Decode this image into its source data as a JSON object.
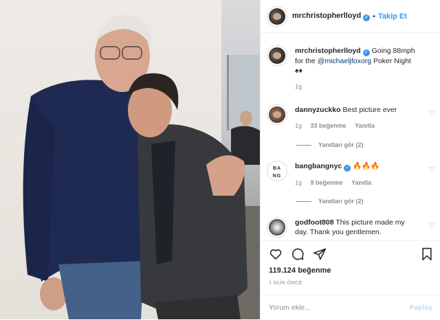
{
  "photo": {
    "alt": ""
  },
  "header": {
    "username": "mrchristopherlloyd",
    "separator": "•",
    "follow_label": "Takip Et"
  },
  "caption": {
    "username": "mrchristopherlloyd",
    "text_before": "Going 88mph for the ",
    "mention": "@michaeljfoxorg",
    "text_after": " Poker Night",
    "suits": "♠♦",
    "time": "1g"
  },
  "comments": [
    {
      "username": "dannyzuckko",
      "text": "Best picture ever",
      "time": "1g",
      "likes": "33 beğenme",
      "reply": "Yanıtla",
      "replies": "Yanıtları gör (2)"
    },
    {
      "username": "bangbangnyc",
      "avatar_text": "BA NG",
      "text": "🔥🔥🔥",
      "time": "1g",
      "likes": "9 beğenme",
      "reply": "Yanıtla",
      "replies": "Yanıtları gör (2)"
    },
    {
      "username": "godfoot808",
      "text": "This picture made my day. Thank you gentlemen."
    }
  ],
  "actions": {
    "likes": "119.124 beğenme",
    "date": "1 GÜN ÖNCE"
  },
  "comment_box": {
    "placeholder": "Yorum ekle...",
    "post_label": "Paylaş"
  },
  "colors": {
    "accent": "#3897f0",
    "post_disabled": "#b2dffc",
    "muted": "#8e8e8e"
  },
  "icons": [
    "verified-icon",
    "heart-icon",
    "comment-icon",
    "share-icon",
    "bookmark-icon"
  ]
}
